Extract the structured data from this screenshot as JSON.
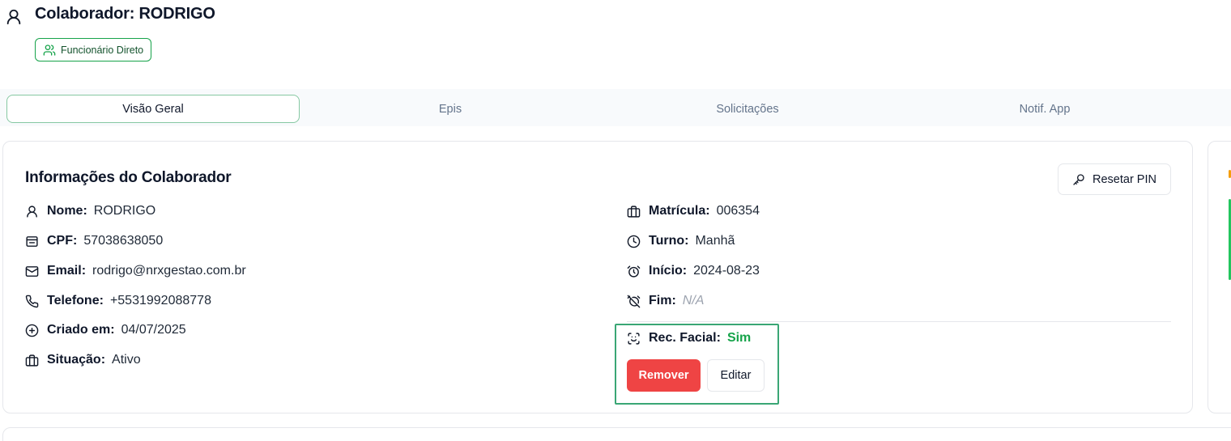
{
  "header": {
    "title": "Colaborador: RODRIGO",
    "badge": "Funcionário Direto"
  },
  "tabs": [
    {
      "label": "Visão Geral",
      "active": true
    },
    {
      "label": "Epis",
      "active": false
    },
    {
      "label": "Solicitações",
      "active": false
    },
    {
      "label": "Notif. App",
      "active": false
    }
  ],
  "info": {
    "title": "Informações do Colaborador",
    "reset_pin": "Resetar PIN",
    "left": [
      {
        "label": "Nome:",
        "value": "RODRIGO",
        "icon": "user-icon"
      },
      {
        "label": "CPF:",
        "value": "57038638050",
        "icon": "id-card-icon"
      },
      {
        "label": "Email:",
        "value": "rodrigo@nrxgestao.com.br",
        "icon": "mail-icon"
      },
      {
        "label": "Telefone:",
        "value": "+5531992088778",
        "icon": "phone-icon"
      },
      {
        "label": "Criado em:",
        "value": "04/07/2025",
        "icon": "plus-circle-icon"
      },
      {
        "label": "Situação:",
        "value": "Ativo",
        "icon": "briefcase-icon"
      }
    ],
    "right": [
      {
        "label": "Matrícula:",
        "value": "006354",
        "icon": "briefcase-icon"
      },
      {
        "label": "Turno:",
        "value": "Manhã",
        "icon": "clock-icon"
      },
      {
        "label": "Início:",
        "value": "2024-08-23",
        "icon": "alarm-clock-icon"
      },
      {
        "label": "Fim:",
        "value": "N/A",
        "icon": "alarm-clock-off-icon"
      }
    ],
    "facial": {
      "label": "Rec. Facial:",
      "value": "Sim",
      "remove": "Remover",
      "edit": "Editar"
    }
  },
  "colors": {
    "accent": "#16a34a",
    "danger": "#ef4444",
    "highlight_border": "#3aa675"
  }
}
